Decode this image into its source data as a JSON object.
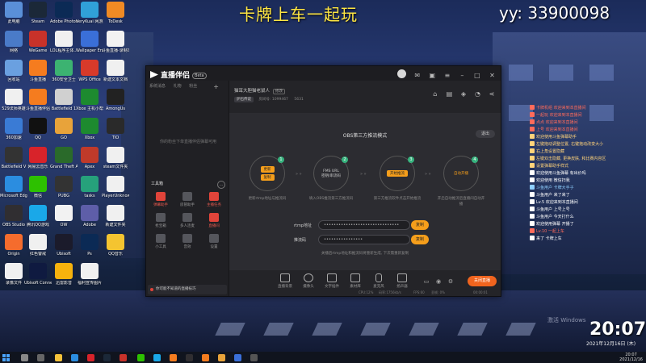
{
  "overlay": {
    "title": "卡牌上车一起玩",
    "yy": "yy: 33900098"
  },
  "desktop_icons": [
    {
      "label": "此电脑",
      "color": "#5a8fd8"
    },
    {
      "label": "Steam",
      "color": "#1b2838"
    },
    {
      "label": "Adobe Photosh...",
      "color": "#0b2a55"
    },
    {
      "label": "VeryKuai 网游加速器",
      "color": "#30a0d8"
    },
    {
      "label": "ToDesk",
      "color": "#f08a24"
    },
    {
      "label": "网络",
      "color": "#4a7bc8"
    },
    {
      "label": "WeGame",
      "color": "#c8322a"
    },
    {
      "label": "LOL程序主体...",
      "color": "#f0f0f0"
    },
    {
      "label": "Wallpaper Engine",
      "color": "#3a6fd8"
    },
    {
      "label": "斗鱼直播·录制本地视频",
      "color": "#f2f2f2"
    },
    {
      "label": "回收站",
      "color": "#6aa0e0"
    },
    {
      "label": "斗鱼直播",
      "color": "#f57c1f"
    },
    {
      "label": "360安全卫士",
      "color": "#3cb371"
    },
    {
      "label": "WPS Office",
      "color": "#d83a2a"
    },
    {
      "label": "新建文本文档",
      "color": "#f0f0f0"
    },
    {
      "label": "529法师英雄",
      "color": "#f0f0f0"
    },
    {
      "label": "斗鱼直播伴侣",
      "color": "#f57c1f"
    },
    {
      "label": "Battlefield 1",
      "color": "#d0d0d0"
    },
    {
      "label": "Xbox 主机小帮手",
      "color": "#1d8a2f"
    },
    {
      "label": "AmongUs",
      "color": "#222"
    },
    {
      "label": "360加速",
      "color": "#3a7bd5"
    },
    {
      "label": "QQ",
      "color": "#111"
    },
    {
      "label": "GO",
      "color": "#e8a33a"
    },
    {
      "label": "Xbox",
      "color": "#1d8a2f"
    },
    {
      "label": "TIO",
      "color": "#2a2a2a"
    },
    {
      "label": "Battlefield V",
      "color": "#333"
    },
    {
      "label": "网易云音乐",
      "color": "#d8232a"
    },
    {
      "label": "Grand Theft Auto V",
      "color": "#2a6a2a"
    },
    {
      "label": "Apex",
      "color": "#c03a2a"
    },
    {
      "label": "steam文件夹",
      "color": "#f0f0f0"
    },
    {
      "label": "Microsoft Edge",
      "color": "#2b8de0"
    },
    {
      "label": "微信",
      "color": "#2dc100"
    },
    {
      "label": "PUBG",
      "color": "#333"
    },
    {
      "label": "tasks",
      "color": "#26a17b"
    },
    {
      "label": "PlayerUnknown's",
      "color": "#f0f0f0"
    },
    {
      "label": "OBS Studio",
      "color": "#302e31"
    },
    {
      "label": "腾讯QQ游戏",
      "color": "#1aa8e8"
    },
    {
      "label": "OW",
      "color": "#f2f2f2"
    },
    {
      "label": "Adobe",
      "color": "#5e5ea8"
    },
    {
      "label": "新建文件夹",
      "color": "#f0f0f0"
    },
    {
      "label": "Origin",
      "color": "#f56c2d"
    },
    {
      "label": "红色警戒",
      "color": "#f0f0f0"
    },
    {
      "label": "Ubisoft",
      "color": "#1b1b2b"
    },
    {
      "label": "Ps",
      "color": "#0b2a55"
    },
    {
      "label": "QQ音乐",
      "color": "#f4c430"
    },
    {
      "label": "录像文件",
      "color": "#f0f0f0"
    },
    {
      "label": "Ubisoft Connect",
      "color": "#0f1a40"
    },
    {
      "label": "迅雷影音",
      "color": "#f6b20d"
    },
    {
      "label": "福利宣传图片",
      "color": "#f0f0f0"
    }
  ],
  "app": {
    "name": "直播伴侣",
    "beta": "Beta",
    "sidebar": {
      "tabs": [
        "系统消息",
        "礼物",
        "粉丝"
      ],
      "empty_text": "你的粉丝下单直播伴侣弹幕可用",
      "tools_header": "工具箱",
      "tools": [
        {
          "label": "弹幕助手",
          "style": "red"
        },
        {
          "label": "房管助手",
          "style": "gray"
        },
        {
          "label": "主播任务",
          "style": "red"
        },
        {
          "label": "抢宝箱",
          "style": "gray"
        },
        {
          "label": "多人连麦",
          "style": "gray"
        },
        {
          "label": "直播间",
          "style": "red"
        },
        {
          "label": "小工具",
          "style": "gray"
        },
        {
          "label": "音效",
          "style": "gray"
        },
        {
          "label": "设置",
          "style": "gray"
        }
      ],
      "footer": "你可能不知道的直播技巧"
    },
    "room": {
      "title": "猫耳大胆猫老鼠人",
      "tag": "修改",
      "category": "炉石传说",
      "room_no": "房间号: 1099467",
      "fans": "5631"
    },
    "panel": {
      "mode_title": "OBS第三方推流模式",
      "exit": "退出",
      "steps": [
        {
          "num": "1",
          "btn1": "更新",
          "btn2": "复制",
          "desc": "更新rtmp地址与推流码"
        },
        {
          "num": "2",
          "line1": "FMS URL",
          "line2": "密钥/串流码",
          "desc": "填入OBS推流第三方推流码"
        },
        {
          "num": "3",
          "line1": "开始推流",
          "desc": "第三方推流软件点击开始推流"
        },
        {
          "num": "4",
          "line1": "自动开播",
          "desc": "开启自动推流后直播间自动开播"
        }
      ],
      "rtmp_label": "rtmp地址",
      "rtmp_value": "•••••••••••••••••••••••••••••••",
      "key_label": "推流码",
      "key_value": "••••••••••••••••",
      "copy_label": "复制",
      "hint": "关播后rtmp地址和推流码将重新生成, 下次需重新复制"
    },
    "toolbar": {
      "items": [
        "直播背景",
        "摄像头",
        "文字插件",
        "素材库",
        "麦克风",
        "扬声器"
      ],
      "live_button": "关闭直播"
    },
    "statusbar": {
      "left": "CPU:12%",
      "mid": "码率:1756kb/s",
      "fps": "FPS:60",
      "drop": "丢帧: 0%",
      "time": "00:00:01"
    }
  },
  "chat": [
    {
      "text": "卡牌机组  欢迎来到本直播间",
      "color": "#ff6b5b"
    },
    {
      "text": "一起玩  欢迎来到本直播间",
      "color": "#ff6b5b"
    },
    {
      "text": "点点  欢迎来到本直播间",
      "color": "#ff6b5b"
    },
    {
      "text": "上号  欢迎来到本直播间",
      "color": "#ff6b5b"
    },
    {
      "text": "欢迎使用斗鱼弹幕助手",
      "color": "#ffd37a"
    },
    {
      "text": "左键拖动调整位置, 右键拖动改变大小",
      "color": "#ffd37a"
    },
    {
      "text": "右上角设置隐藏",
      "color": "#ffd37a"
    },
    {
      "text": "左键双击隐藏, 更换皮肤, 和比赛内容区",
      "color": "#ffd37a"
    },
    {
      "text": "设置弹幕助手样式",
      "color": "#ffd37a"
    },
    {
      "text": "欢迎使用斗鱼弹幕  有出价吗",
      "color": "#ffffff"
    },
    {
      "text": "欢迎使用  微信扫我",
      "color": "#ffffff"
    },
    {
      "text": "斗鱼用户  卡牌大手子",
      "color": "#8fd0ff"
    },
    {
      "text": "斗鱼用户  来了来了",
      "color": "#ffffff"
    },
    {
      "text": "Lv.5  欢迎来到本直播间",
      "color": "#ffffff"
    },
    {
      "text": "斗鱼用户  上号上号",
      "color": "#ffffff"
    },
    {
      "text": "斗鱼用户  今天打什么",
      "color": "#ffffff"
    },
    {
      "text": "欢迎使用弹幕  开播了",
      "color": "#ffffff"
    },
    {
      "text": "Lv.10  一起上车",
      "color": "#ff6b5b"
    },
    {
      "text": "来了  卡牌上车",
      "color": "#ffffff"
    }
  ],
  "activate_text": "激活 Windows",
  "clock": {
    "time": "20:07",
    "date": "2021年12月16日 (木)",
    "tray_time": "20:07",
    "tray_date": "2021/12/16"
  }
}
